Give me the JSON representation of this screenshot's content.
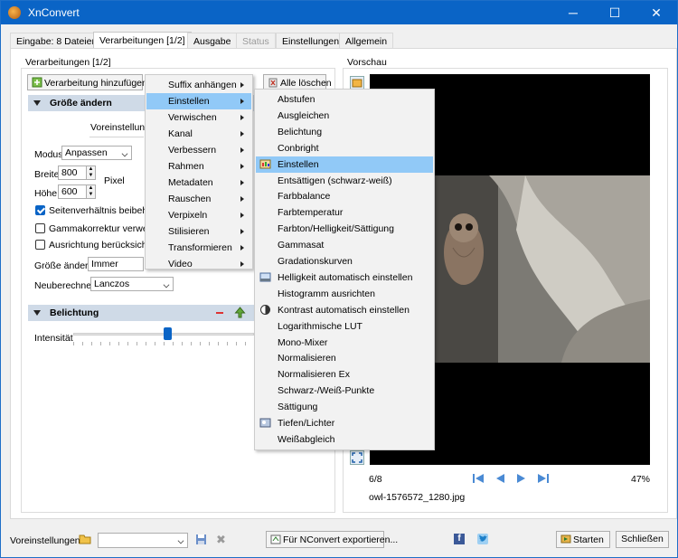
{
  "window": {
    "title": "XnConvert",
    "minimize": "─",
    "maximize": "☐",
    "close": "✕"
  },
  "tabs": [
    {
      "label": "Eingabe: 8 Dateien",
      "state": "normal"
    },
    {
      "label": "Verarbeitungen [1/2]",
      "state": "active"
    },
    {
      "label": "Ausgabe",
      "state": "normal"
    },
    {
      "label": "Status",
      "state": "disabled"
    },
    {
      "label": "Einstellungen",
      "state": "normal"
    },
    {
      "label": "Allgemein",
      "state": "normal"
    }
  ],
  "left_panel": {
    "group_title": "Verarbeitungen [1/2]",
    "add_button": "Verarbeitung hinzufügen>",
    "clear_button": "Alle löschen",
    "resize": {
      "header": "Größe ändern",
      "presets_label": "Voreinstellunge",
      "mode_label": "Modus",
      "mode_value": "Anpassen",
      "width_label": "Breite",
      "width_value": "800",
      "height_label": "Höhe",
      "height_value": "600",
      "unit_value": "Pixel",
      "keep_ratio": "Seitenverhältnis beibehalte",
      "keep_ratio_checked": true,
      "gamma": "Gammakorrektur verwende",
      "gamma_checked": false,
      "orientation": "Ausrichtung berücksichtige",
      "orientation_checked": false,
      "resize_label": "Größe ändern",
      "resize_value": "Immer",
      "resample_label": "Neuberechnen",
      "resample_value": "Lanczos"
    },
    "exposure": {
      "header": "Belichtung",
      "intensity_label": "Intensität",
      "intensity_value": 0.52
    }
  },
  "menu_main": [
    {
      "label": "Suffix anhängen",
      "submenu": true,
      "highlight": false
    },
    {
      "label": "Einstellen",
      "submenu": true,
      "highlight": true
    },
    {
      "label": "Verwischen",
      "submenu": true,
      "highlight": false
    },
    {
      "label": "Kanal",
      "submenu": true,
      "highlight": false
    },
    {
      "label": "Verbessern",
      "submenu": true,
      "highlight": false
    },
    {
      "label": "Rahmen",
      "submenu": true,
      "highlight": false
    },
    {
      "label": "Metadaten",
      "submenu": true,
      "highlight": false
    },
    {
      "label": "Rauschen",
      "submenu": true,
      "highlight": false
    },
    {
      "label": "Verpixeln",
      "submenu": true,
      "highlight": false
    },
    {
      "label": "Stilisieren",
      "submenu": true,
      "highlight": false
    },
    {
      "label": "Transformieren",
      "submenu": true,
      "highlight": false
    },
    {
      "label": "Video",
      "submenu": true,
      "highlight": false
    }
  ],
  "menu_sub": [
    {
      "label": "Abstufen",
      "icon": "",
      "highlight": false
    },
    {
      "label": "Ausgleichen",
      "icon": "",
      "highlight": false
    },
    {
      "label": "Belichtung",
      "icon": "",
      "highlight": false
    },
    {
      "label": "Conbright",
      "icon": "",
      "highlight": false
    },
    {
      "label": "Einstellen",
      "icon": "adjust-icon",
      "highlight": true
    },
    {
      "label": "Entsättigen (schwarz-weiß)",
      "icon": "",
      "highlight": false
    },
    {
      "label": "Farbbalance",
      "icon": "",
      "highlight": false
    },
    {
      "label": "Farbtemperatur",
      "icon": "",
      "highlight": false
    },
    {
      "label": "Farbton/Helligkeit/Sättigung",
      "icon": "",
      "highlight": false
    },
    {
      "label": "Gammasat",
      "icon": "",
      "highlight": false
    },
    {
      "label": "Gradationskurven",
      "icon": "",
      "highlight": false
    },
    {
      "label": "Helligkeit automatisch einstellen",
      "icon": "auto-brightness-icon",
      "highlight": false
    },
    {
      "label": "Histogramm ausrichten",
      "icon": "",
      "highlight": false
    },
    {
      "label": "Kontrast automatisch einstellen",
      "icon": "auto-contrast-icon",
      "highlight": false
    },
    {
      "label": "Logarithmische LUT",
      "icon": "",
      "highlight": false
    },
    {
      "label": "Mono-Mixer",
      "icon": "",
      "highlight": false
    },
    {
      "label": "Normalisieren",
      "icon": "",
      "highlight": false
    },
    {
      "label": "Normalisieren Ex",
      "icon": "",
      "highlight": false
    },
    {
      "label": "Schwarz-/Weiß-Punkte",
      "icon": "",
      "highlight": false
    },
    {
      "label": "Sättigung",
      "icon": "",
      "highlight": false
    },
    {
      "label": "Tiefen/Lichter",
      "icon": "shadows-highlights-icon",
      "highlight": false
    },
    {
      "label": "Weißabgleich",
      "icon": "",
      "highlight": false
    }
  ],
  "preview": {
    "group_title": "Vorschau",
    "counter": "6/8",
    "zoom": "47%",
    "filename": "owl-1576572_1280.jpg"
  },
  "bottom": {
    "presets_label": "Voreinstellungen:",
    "export_button": "Für NConvert exportieren...",
    "start_button": "Starten",
    "close_button": "Schließen"
  },
  "colors": {
    "accent": "#0a64c6",
    "menu_highlight": "#91c9f7",
    "panel_header": "#cfdae7"
  }
}
